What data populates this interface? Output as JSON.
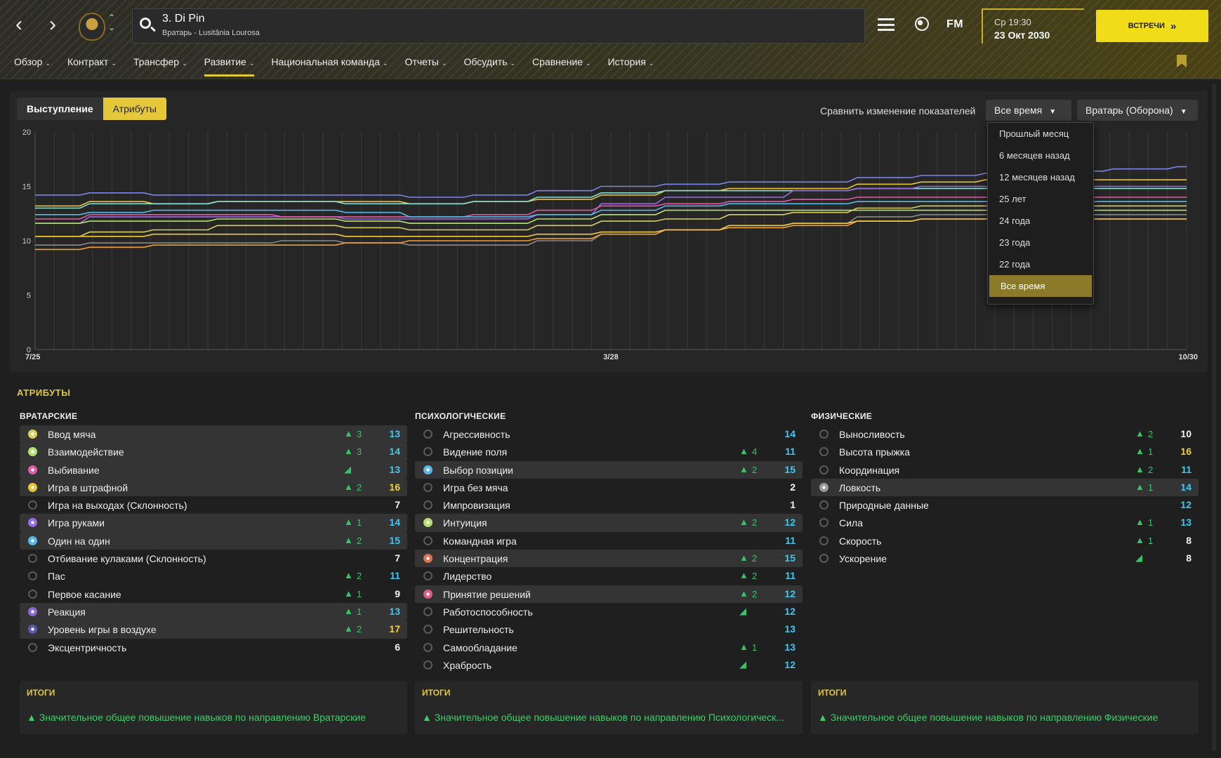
{
  "header": {
    "back_icon": "‹",
    "forward_icon": "›",
    "player_name": "3. Di Pin",
    "player_subtitle": "Вратарь - Lusitânia Lourosa",
    "fm_logo": "FM",
    "clock_day": "Ср 19:30",
    "clock_date": "23 Окт 2030",
    "meet_button": "ВСТРЕЧИ"
  },
  "menu": [
    {
      "label": "Обзор"
    },
    {
      "label": "Контракт"
    },
    {
      "label": "Трансфер"
    },
    {
      "label": "Развитие"
    },
    {
      "label": "Национальная команда"
    },
    {
      "label": "Отчеты"
    },
    {
      "label": "Обсудить"
    },
    {
      "label": "Сравнение"
    },
    {
      "label": "История"
    }
  ],
  "toolbar": {
    "tab_performance": "Выступление",
    "tab_attributes": "Атрибуты",
    "compare_label": "Сравнить изменение показателей",
    "period_value": "Все время",
    "role_value": "Вратарь (Оборона)"
  },
  "period_options": [
    "Прошлый месяц",
    "6 месяцев назад",
    "12 месяцев назад",
    "25 лет",
    "24 года",
    "23 года",
    "22 года",
    "Все время"
  ],
  "chart_data": {
    "type": "line",
    "x_labels": [
      "7/25",
      "3/28",
      "10/30"
    ],
    "ylim": [
      0,
      20
    ],
    "yticks": [
      0,
      5,
      10,
      15,
      20
    ],
    "series": [
      {
        "color": "#7c84e8",
        "values": [
          14.2,
          14.4,
          14.2,
          14.2,
          14.2,
          14.2,
          14.0,
          14.2,
          14.6,
          15.0,
          15.2,
          15.4,
          15.4,
          15.8,
          16.0,
          16.2,
          16.4,
          16.6,
          16.8
        ]
      },
      {
        "color": "#e8c43a",
        "values": [
          13.2,
          13.6,
          13.4,
          13.6,
          13.6,
          13.6,
          13.4,
          13.6,
          13.8,
          14.2,
          14.6,
          14.8,
          14.8,
          15.2,
          15.4,
          15.6,
          15.6,
          15.6,
          15.6
        ]
      },
      {
        "color": "#8ae0d0",
        "values": [
          13.0,
          13.4,
          13.4,
          13.6,
          13.6,
          13.4,
          13.4,
          13.6,
          14.0,
          14.4,
          14.6,
          14.6,
          14.6,
          14.8,
          14.8,
          14.8,
          14.8,
          14.8,
          14.8
        ]
      },
      {
        "color": "#9b6be0",
        "values": [
          11.6,
          12.2,
          12.2,
          12.2,
          12.2,
          12.0,
          12.0,
          12.0,
          12.4,
          13.4,
          14.0,
          14.0,
          14.6,
          14.8,
          15.0,
          15.0,
          15.0,
          15.0,
          15.0
        ]
      },
      {
        "color": "#e05ca6",
        "values": [
          12.0,
          12.4,
          12.4,
          12.4,
          12.2,
          12.2,
          12.2,
          12.4,
          12.8,
          13.2,
          13.4,
          13.6,
          13.8,
          14.0,
          14.0,
          14.0,
          14.0,
          14.0,
          14.0
        ]
      },
      {
        "color": "#5ab8e8",
        "values": [
          12.4,
          12.6,
          12.8,
          12.8,
          12.8,
          12.6,
          12.2,
          12.2,
          12.4,
          12.8,
          13.2,
          13.4,
          13.4,
          13.6,
          13.6,
          13.6,
          13.6,
          13.6,
          13.6
        ]
      },
      {
        "color": "#b8e070",
        "values": [
          11.6,
          11.8,
          11.8,
          12.0,
          12.0,
          11.8,
          11.6,
          11.6,
          12.0,
          12.4,
          12.8,
          12.8,
          12.8,
          12.8,
          12.8,
          12.8,
          12.8,
          12.8,
          12.8
        ]
      },
      {
        "color": "#d8d060",
        "values": [
          10.4,
          10.8,
          11.0,
          11.4,
          11.4,
          11.2,
          11.0,
          11.0,
          11.4,
          11.8,
          12.0,
          12.4,
          12.6,
          13.0,
          13.2,
          13.2,
          13.2,
          13.2,
          13.2
        ]
      },
      {
        "color": "#8a8a8a",
        "values": [
          9.6,
          9.8,
          9.8,
          9.8,
          10.0,
          9.8,
          9.6,
          9.6,
          10.0,
          10.6,
          11.0,
          11.4,
          11.6,
          12.2,
          12.4,
          12.4,
          12.4,
          12.4,
          12.4
        ]
      },
      {
        "color": "#f0a030",
        "values": [
          9.2,
          9.4,
          9.6,
          9.6,
          9.6,
          9.8,
          10.0,
          10.0,
          10.2,
          10.6,
          11.0,
          11.2,
          11.4,
          11.8,
          12.0,
          12.0,
          12.0,
          12.0,
          12.0
        ]
      },
      {
        "color": "#f2c840",
        "values": [
          10.4,
          10.4,
          10.6,
          10.6,
          10.6,
          10.4,
          10.4,
          10.4,
          10.6,
          10.8,
          11.0,
          11.4,
          11.6,
          11.8,
          12.0,
          12.0,
          12.0,
          12.0,
          12.0
        ]
      }
    ]
  },
  "attributes_title": "АТРИБУТЫ",
  "columns": [
    {
      "header": "ВРАТАРСКИЕ",
      "rows": [
        {
          "name": "Ввод мяча",
          "up": "3",
          "value": "13",
          "hl": true,
          "ic": "#d8d060"
        },
        {
          "name": "Взаимодействие",
          "up": "3",
          "value": "14",
          "hl": true,
          "ic": "#b8e070"
        },
        {
          "name": "Выбивание",
          "up": "",
          "arrow": "◢",
          "value": "13",
          "hl": true,
          "ic": "#e05ca6"
        },
        {
          "name": "Игра в штрафной",
          "up": "2",
          "value": "16",
          "hl": true,
          "ic": "#e8c43a"
        },
        {
          "name": "Игра на выходах (Склонность)",
          "up": "",
          "value": "7",
          "hl": false,
          "ic": ""
        },
        {
          "name": "Игра руками",
          "up": "1",
          "value": "14",
          "hl": true,
          "ic": "#9b6be0"
        },
        {
          "name": "Один на один",
          "up": "2",
          "value": "15",
          "hl": true,
          "ic": "#5ab8e8"
        },
        {
          "name": "Отбивание кулаками (Склонность)",
          "up": "",
          "value": "7",
          "hl": false,
          "ic": ""
        },
        {
          "name": "Пас",
          "up": "2",
          "value": "11",
          "hl": false,
          "ic": ""
        },
        {
          "name": "Первое касание",
          "up": "1",
          "value": "9",
          "hl": false,
          "ic": ""
        },
        {
          "name": "Реакция",
          "up": "1",
          "value": "13",
          "hl": true,
          "ic": "#8a6ad0"
        },
        {
          "name": "Уровень игры в воздухе",
          "up": "2",
          "value": "17",
          "hl": true,
          "ic": "#5a5ab0"
        },
        {
          "name": "Эксцентричность",
          "up": "",
          "value": "6",
          "hl": false,
          "ic": ""
        }
      ]
    },
    {
      "header": "ПСИХОЛОГИЧЕСКИЕ",
      "rows": [
        {
          "name": "Агрессивность",
          "up": "",
          "value": "14",
          "hl": false,
          "ic": ""
        },
        {
          "name": "Видение поля",
          "up": "4",
          "value": "11",
          "hl": false,
          "ic": ""
        },
        {
          "name": "Выбор позиции",
          "up": "2",
          "value": "15",
          "hl": true,
          "ic": "#5ab8e8"
        },
        {
          "name": "Игра без мяча",
          "up": "",
          "value": "2",
          "hl": false,
          "ic": ""
        },
        {
          "name": "Импровизация",
          "up": "",
          "value": "1",
          "hl": false,
          "ic": ""
        },
        {
          "name": "Интуиция",
          "up": "2",
          "value": "12",
          "hl": true,
          "ic": "#b8e070"
        },
        {
          "name": "Командная игра",
          "up": "",
          "value": "11",
          "hl": false,
          "ic": ""
        },
        {
          "name": "Концентрация",
          "up": "2",
          "value": "15",
          "hl": true,
          "ic": "#e07050"
        },
        {
          "name": "Лидерство",
          "up": "2",
          "value": "11",
          "hl": false,
          "ic": ""
        },
        {
          "name": "Принятие решений",
          "up": "2",
          "value": "12",
          "hl": true,
          "ic": "#e05c8a"
        },
        {
          "name": "Работоспособность",
          "up": "",
          "arrow": "◢",
          "value": "12",
          "hl": false,
          "ic": ""
        },
        {
          "name": "Решительность",
          "up": "",
          "value": "13",
          "hl": false,
          "ic": ""
        },
        {
          "name": "Самообладание",
          "up": "1",
          "value": "13",
          "hl": false,
          "ic": ""
        },
        {
          "name": "Храбрость",
          "up": "",
          "arrow": "◢",
          "value": "12",
          "hl": false,
          "ic": ""
        }
      ]
    },
    {
      "header": "ФИЗИЧЕСКИЕ",
      "rows": [
        {
          "name": "Выносливость",
          "up": "2",
          "value": "10",
          "hl": false,
          "ic": ""
        },
        {
          "name": "Высота прыжка",
          "up": "1",
          "value": "16",
          "hl": false,
          "ic": ""
        },
        {
          "name": "Координация",
          "up": "2",
          "value": "11",
          "hl": false,
          "ic": ""
        },
        {
          "name": "Ловкость",
          "up": "1",
          "value": "14",
          "hl": true,
          "ic": "#9a9a9a"
        },
        {
          "name": "Природные данные",
          "up": "",
          "value": "12",
          "hl": false,
          "ic": ""
        },
        {
          "name": "Сила",
          "up": "1",
          "value": "13",
          "hl": false,
          "ic": ""
        },
        {
          "name": "Скорость",
          "up": "1",
          "value": "8",
          "hl": false,
          "ic": ""
        },
        {
          "name": "Ускорение",
          "up": "",
          "arrow": "◢",
          "value": "8",
          "hl": false,
          "ic": ""
        }
      ]
    }
  ],
  "summaries": [
    {
      "header": "ИТОГИ",
      "text": "Значительное общее повышение навыков по направлению Вратарские"
    },
    {
      "header": "ИТОГИ",
      "text": "Значительное общее повышение навыков по направлению Психологическ..."
    },
    {
      "header": "ИТОГИ",
      "text": "Значительное общее повышение навыков по направлению Физические"
    }
  ]
}
